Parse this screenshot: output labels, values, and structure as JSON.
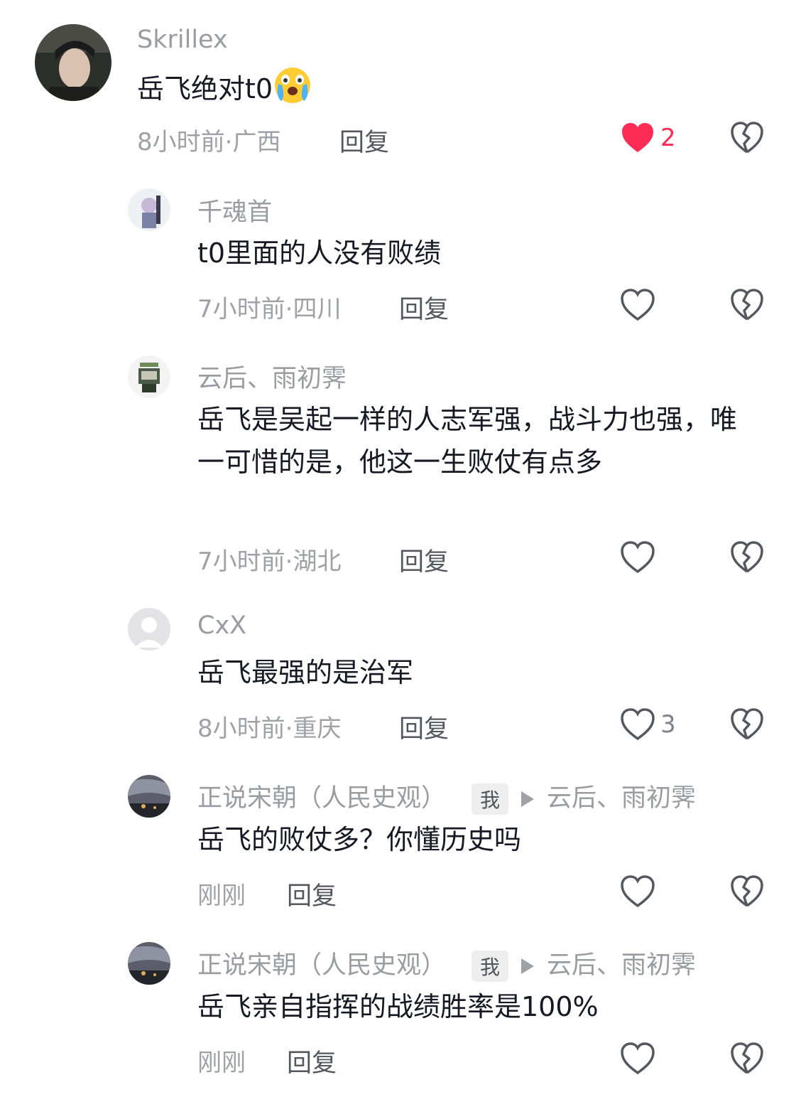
{
  "comments": [
    {
      "name": "Skrillex",
      "text": "岳飞绝对t0",
      "time": "8小时前·广西",
      "reply": "回复",
      "likes": "2",
      "liked": true
    },
    {
      "name": "千魂首",
      "text": "t0里面的人没有败绩",
      "time": "7小时前·四川",
      "reply": "回复",
      "likes": ""
    },
    {
      "name": "云后、雨初霁",
      "text": "岳飞是吴起一样的人志军强，战斗力也强，唯一可惜的是，他这一生败仗有点多",
      "time": "7小时前·湖北",
      "reply": "回复",
      "likes": ""
    },
    {
      "name": "CxX",
      "text": "岳飞最强的是治军",
      "time": "8小时前·重庆",
      "reply": "回复",
      "likes": "3"
    },
    {
      "name": "正说宋朝（人民史观）",
      "tag": "我",
      "reply_to": "云后、雨初霁",
      "text": "岳飞的败仗多？你懂历史吗",
      "time": "刚刚",
      "reply": "回复",
      "likes": ""
    },
    {
      "name": "正说宋朝（人民史观）",
      "tag": "我",
      "reply_to": "云后、雨初霁",
      "text": "岳飞亲自指挥的战绩胜率是100%",
      "time": "刚刚",
      "reply": "回复",
      "likes": ""
    }
  ],
  "icons": {
    "like": "heart-icon",
    "dislike": "broken-heart-icon",
    "emoji": "crying-face-emoji"
  },
  "colors": {
    "liked": "#fe2c55",
    "meta": "#a0a1a6",
    "text": "#161823"
  }
}
